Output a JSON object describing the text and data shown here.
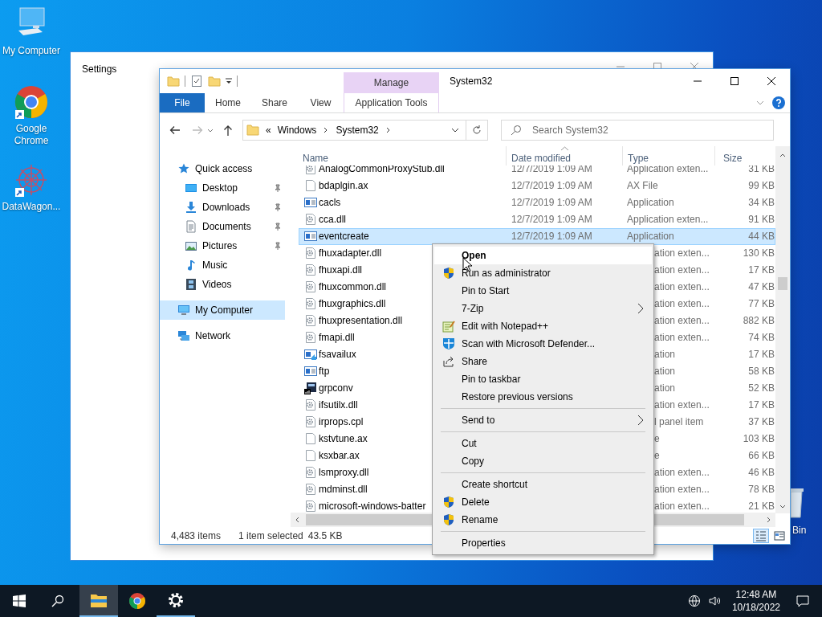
{
  "desktop": {
    "icons": [
      {
        "label": "My Computer",
        "kind": "computer",
        "shortcut": false
      },
      {
        "label": "Google Chrome",
        "kind": "chrome",
        "shortcut": true
      },
      {
        "label": "DataWagon...",
        "kind": "datawagon",
        "shortcut": true
      }
    ],
    "recycle_bin": {
      "label": "Bin"
    }
  },
  "settings_window": {
    "title": "Settings"
  },
  "explorer": {
    "title": "System32",
    "context_group": "Manage",
    "tabs": [
      {
        "label": "File",
        "kind": "file",
        "selected": false
      },
      {
        "label": "Home",
        "kind": "plain",
        "selected": false
      },
      {
        "label": "Share",
        "kind": "plain",
        "selected": false
      },
      {
        "label": "View",
        "kind": "plain",
        "selected": false
      },
      {
        "label": "Application Tools",
        "kind": "context",
        "selected": false
      }
    ],
    "address": {
      "overflow": "«",
      "path": [
        "Windows",
        "System32"
      ]
    },
    "search": {
      "placeholder": "Search System32"
    },
    "navigation": [
      {
        "label": "Quick access",
        "kind": "star",
        "selected": false,
        "children": [
          {
            "label": "Desktop",
            "kind": "desktop",
            "pinned": true,
            "selected": false
          },
          {
            "label": "Downloads",
            "kind": "download",
            "pinned": true,
            "selected": false
          },
          {
            "label": "Documents",
            "kind": "document",
            "pinned": true,
            "selected": false
          },
          {
            "label": "Pictures",
            "kind": "picture",
            "pinned": true,
            "selected": false
          },
          {
            "label": "Music",
            "kind": "music",
            "pinned": false,
            "selected": false
          },
          {
            "label": "Videos",
            "kind": "video",
            "pinned": false,
            "selected": false
          }
        ]
      },
      {
        "label": "My Computer",
        "kind": "computer",
        "selected": true
      },
      {
        "label": "Network",
        "kind": "network",
        "selected": false
      }
    ],
    "columns": [
      {
        "label": "Name",
        "sorted": false
      },
      {
        "label": "Date modified",
        "sorted": true
      },
      {
        "label": "Type",
        "sorted": false
      },
      {
        "label": "Size",
        "sorted": false
      }
    ],
    "rows": [
      {
        "name": "AnalogCommonProxyStub.dll",
        "kind": "dll",
        "date": "12/7/2019 1:09 AM",
        "type": "Application exten...",
        "size": "31 KB",
        "selected": false
      },
      {
        "name": "bdaplgin.ax",
        "kind": "file",
        "date": "12/7/2019 1:09 AM",
        "type": "AX File",
        "size": "99 KB",
        "selected": false
      },
      {
        "name": "cacls",
        "kind": "app",
        "date": "12/7/2019 1:09 AM",
        "type": "Application",
        "size": "34 KB",
        "selected": false
      },
      {
        "name": "cca.dll",
        "kind": "dll",
        "date": "12/7/2019 1:09 AM",
        "type": "Application exten...",
        "size": "91 KB",
        "selected": false
      },
      {
        "name": "eventcreate",
        "kind": "app",
        "date": "12/7/2019 1:09 AM",
        "type": "Application",
        "size": "44 KB",
        "selected": true
      },
      {
        "name": "fhuxadapter.dll",
        "kind": "dll",
        "type": "ation exten...",
        "size": "130 KB",
        "selected": false
      },
      {
        "name": "fhuxapi.dll",
        "kind": "dll",
        "type": "ation exten...",
        "size": "17 KB",
        "selected": false
      },
      {
        "name": "fhuxcommon.dll",
        "kind": "dll",
        "type": "ation exten...",
        "size": "47 KB",
        "selected": false
      },
      {
        "name": "fhuxgraphics.dll",
        "kind": "dll",
        "type": "ation exten...",
        "size": "77 KB",
        "selected": false
      },
      {
        "name": "fhuxpresentation.dll",
        "kind": "dll",
        "type": "ation exten...",
        "size": "882 KB",
        "selected": false
      },
      {
        "name": "fmapi.dll",
        "kind": "dll",
        "type": "ation exten...",
        "size": "74 KB",
        "selected": false
      },
      {
        "name": "fsavailux",
        "kind": "app-arrow",
        "type": "ation",
        "size": "17 KB",
        "selected": false
      },
      {
        "name": "ftp",
        "kind": "app",
        "type": "ation",
        "size": "58 KB",
        "selected": false
      },
      {
        "name": "grpconv",
        "kind": "installer",
        "type": "ation",
        "size": "52 KB",
        "selected": false
      },
      {
        "name": "ifsutilx.dll",
        "kind": "dll",
        "type": "ation exten...",
        "size": "17 KB",
        "selected": false
      },
      {
        "name": "irprops.cpl",
        "kind": "dll",
        "type": "l panel item",
        "size": "37 KB",
        "selected": false
      },
      {
        "name": "kstvtune.ax",
        "kind": "file",
        "type": "e",
        "size": "103 KB",
        "selected": false
      },
      {
        "name": "ksxbar.ax",
        "kind": "file",
        "type": "e",
        "size": "66 KB",
        "selected": false
      },
      {
        "name": "lsmproxy.dll",
        "kind": "dll",
        "type": "ation exten...",
        "size": "46 KB",
        "selected": false
      },
      {
        "name": "mdminst.dll",
        "kind": "dll",
        "type": "ation exten...",
        "size": "78 KB",
        "selected": false
      },
      {
        "name": "microsoft-windows-batter",
        "kind": "dll",
        "type": "ation exten...",
        "size": "21 KB",
        "selected": false
      }
    ],
    "status": {
      "count": "4,483 items",
      "selection": "1 item selected",
      "selection_size": "43.5 KB"
    },
    "views": [
      {
        "kind": "details",
        "selected": true
      },
      {
        "kind": "tiles",
        "selected": false
      }
    ]
  },
  "context_menu": {
    "groups": [
      [
        {
          "label": "Open",
          "kind": "plain",
          "default": true,
          "selected": true,
          "submenu": false
        },
        {
          "label": "Run as administrator",
          "kind": "shield",
          "default": false,
          "selected": false,
          "submenu": false
        },
        {
          "label": "Pin to Start",
          "kind": "plain",
          "default": false,
          "selected": false,
          "submenu": false
        },
        {
          "label": "7-Zip",
          "kind": "plain",
          "default": false,
          "selected": false,
          "submenu": true
        },
        {
          "label": "Edit with Notepad++",
          "kind": "notepad",
          "default": false,
          "selected": false,
          "submenu": false
        },
        {
          "label": "Scan with Microsoft Defender...",
          "kind": "defender",
          "default": false,
          "selected": false,
          "submenu": false
        },
        {
          "label": "Share",
          "kind": "share",
          "default": false,
          "selected": false,
          "submenu": false
        },
        {
          "label": "Pin to taskbar",
          "kind": "plain",
          "default": false,
          "selected": false,
          "submenu": false
        },
        {
          "label": "Restore previous versions",
          "kind": "plain",
          "default": false,
          "selected": false,
          "submenu": false
        }
      ],
      [
        {
          "label": "Send to",
          "kind": "plain",
          "default": false,
          "selected": false,
          "submenu": true
        }
      ],
      [
        {
          "label": "Cut",
          "kind": "plain",
          "default": false,
          "selected": false,
          "submenu": false
        },
        {
          "label": "Copy",
          "kind": "plain",
          "default": false,
          "selected": false,
          "submenu": false
        }
      ],
      [
        {
          "label": "Create shortcut",
          "kind": "plain",
          "default": false,
          "selected": false,
          "submenu": false
        },
        {
          "label": "Delete",
          "kind": "shield",
          "default": false,
          "selected": false,
          "submenu": false
        },
        {
          "label": "Rename",
          "kind": "shield",
          "default": false,
          "selected": false,
          "submenu": false
        }
      ],
      [
        {
          "label": "Properties",
          "kind": "plain",
          "default": false,
          "selected": false,
          "submenu": false
        }
      ]
    ]
  },
  "taskbar": {
    "items": [
      {
        "kind": "start",
        "running": false,
        "active": false
      },
      {
        "kind": "search",
        "running": false,
        "active": false
      },
      {
        "kind": "explorer",
        "running": true,
        "active": true
      },
      {
        "kind": "chrome",
        "running": false,
        "active": false
      },
      {
        "kind": "settings",
        "running": true,
        "active": false
      }
    ],
    "clock": {
      "time": "12:48 AM",
      "date": "10/18/2022"
    }
  }
}
